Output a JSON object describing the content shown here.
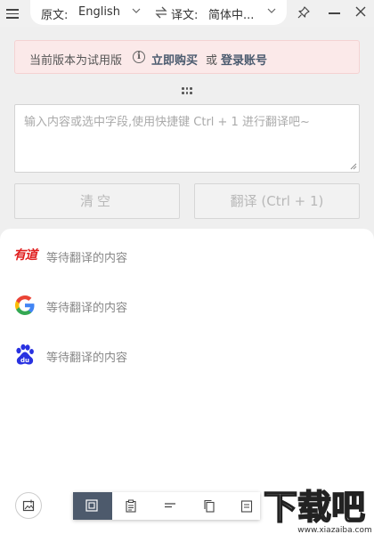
{
  "titlebar": {
    "source_label": "原文:",
    "source_value": "English",
    "target_label": "译文:",
    "target_value": "简体中...",
    "icons": [
      "menu-icon",
      "chevron-down-icon",
      "swap-icon",
      "pin-icon",
      "minimize-icon",
      "close-icon"
    ]
  },
  "notice": {
    "text": "当前版本为试用版",
    "buy_link": "立即购买",
    "or_text": "或",
    "login_link": "登录账号",
    "bg_color": "#fbe9e9"
  },
  "input": {
    "value": "",
    "placeholder": "输入内容或选中字段,使用快捷键 Ctrl + 1 进行翻译吧~"
  },
  "buttons": {
    "clear": "清空",
    "translate": "翻译 (Ctrl + 1)"
  },
  "results": [
    {
      "service": "youdao",
      "logo_text": "有道",
      "text": "等待翻译的内容"
    },
    {
      "service": "google",
      "text": "等待翻译的内容"
    },
    {
      "service": "baidu",
      "logo_text": "du",
      "text": "等待翻译的内容"
    }
  ],
  "toolbar": {
    "tools": [
      "screenshot-ocr-icon",
      "clipboard-icon",
      "text-align-icon",
      "copy-icon",
      "document-icon"
    ],
    "active_color": "#4d5a6c"
  },
  "watermark": {
    "text": "下载吧",
    "url": "www.xiazaiba.com"
  }
}
